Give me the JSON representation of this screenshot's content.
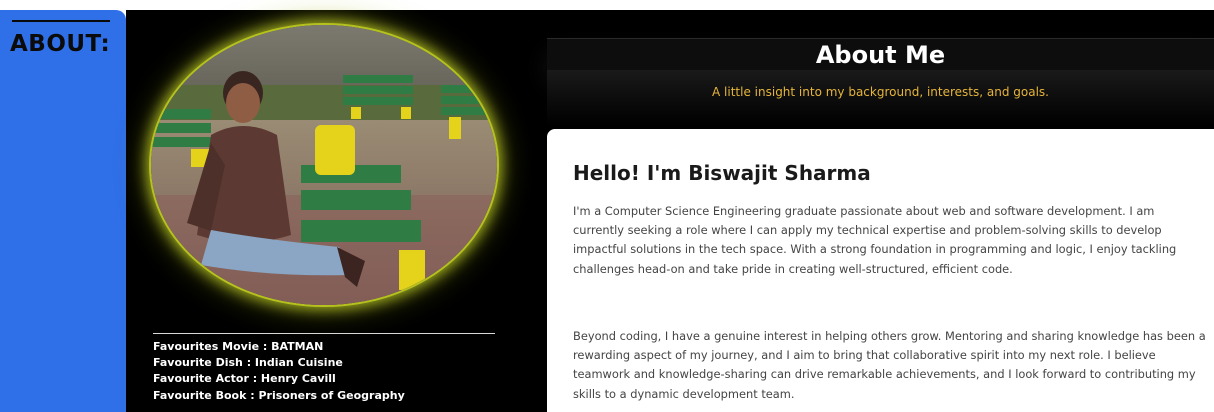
{
  "sidebar": {
    "label": "ABOUT:"
  },
  "header": {
    "title": "About Me",
    "subtitle": "A little insight into my background, interests, and goals."
  },
  "profile": {
    "photo_icon": "profile-photo",
    "favourites": [
      "Favourites Movie : BATMAN",
      "Favourite Dish : Indian Cuisine",
      "Favourite Actor : Henry Cavill",
      "Favourite Book : Prisoners of Geography"
    ]
  },
  "intro": {
    "heading": "Hello! I'm Biswajit Sharma",
    "paragraph1": "I'm a Computer Science Engineering graduate passionate about web and software development. I am currently seeking a role where I can apply my technical expertise and problem-solving skills to develop impactful solutions in the tech space. With a strong foundation in programming and logic, I enjoy tackling challenges head-on and take pride in creating well-structured, efficient code.",
    "paragraph2": "Beyond coding, I have a genuine interest in helping others grow. Mentoring and sharing knowledge has been a rewarding aspect of my journey, and I aim to bring that collaborative spirit into my next role. I believe teamwork and knowledge-sharing can drive remarkable achievements, and I look forward to contributing my skills to a dynamic development team."
  },
  "colors": {
    "sidebar": "#2f6fe8",
    "accent_glow": "#b5c21e",
    "subtitle": "#e6b53a"
  }
}
